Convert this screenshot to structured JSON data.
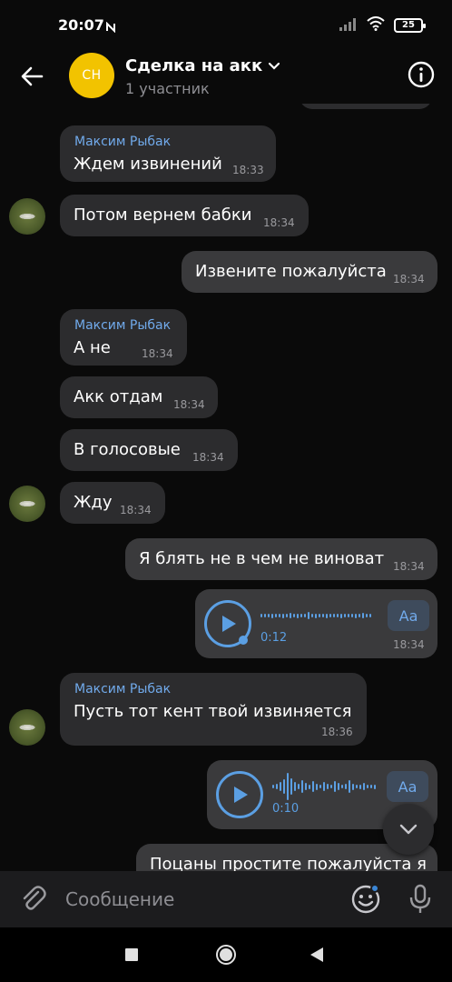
{
  "status_bar": {
    "time": "20:07",
    "battery": "25"
  },
  "header": {
    "avatar_initials": "СН",
    "title": "Сделка на акк",
    "subtitle": "1 участник"
  },
  "messages": [
    {
      "sender": "Максим Рыбак",
      "text": "Ждем извинений",
      "time": "18:33"
    },
    {
      "text": "Потом вернем бабки",
      "time": "18:34"
    },
    {
      "text": "Извените пожалуйста",
      "time": "18:34"
    },
    {
      "sender": "Максим Рыбак",
      "text": "А не",
      "time": "18:34"
    },
    {
      "text": "Акк отдам",
      "time": "18:34"
    },
    {
      "text": "В голосовые",
      "time": "18:34"
    },
    {
      "text": "Жду",
      "time": "18:34"
    },
    {
      "text": "Я блять не в чем не виноват",
      "time": "18:34"
    },
    {
      "voice_duration": "0:12",
      "transcribe_label": "Aa",
      "time": "18:34"
    },
    {
      "sender": "Максим Рыбак",
      "text": "Пусть тот кент твой извиняется",
      "time": "18:36"
    },
    {
      "voice_duration": "0:10",
      "transcribe_label": "Aa"
    },
    {
      "text": "Поцаны простите пожалуйста я"
    }
  ],
  "composer": {
    "placeholder": "Сообщение"
  },
  "colors": {
    "accent": "#5b9fe3",
    "avatar_bg": "#f2c300",
    "bubble": "#2c2c2e",
    "sender_name": "#71aaeb"
  }
}
